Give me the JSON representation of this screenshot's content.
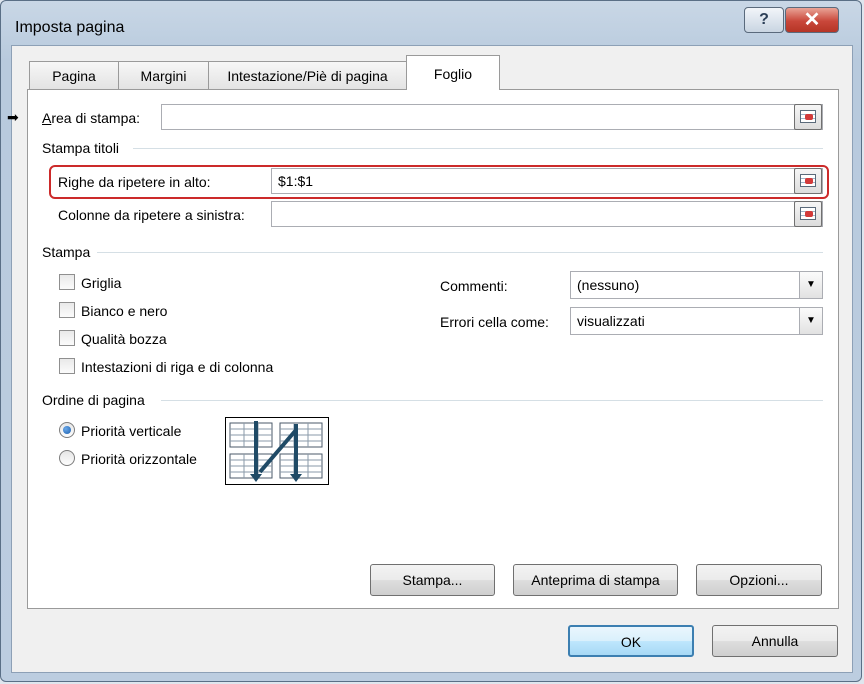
{
  "window": {
    "title": "Imposta pagina",
    "help_glyph": "?",
    "close_glyph": "✕"
  },
  "tabs": [
    {
      "label": "Pagina",
      "active": false
    },
    {
      "label": "Margini",
      "active": false
    },
    {
      "label": "Intestazione/Piè di pagina",
      "active": false
    },
    {
      "label": "Foglio",
      "active": true
    }
  ],
  "print_area": {
    "label": "Area di stampa:",
    "value": ""
  },
  "print_titles": {
    "section": "Stampa titoli",
    "rows": {
      "label": "Righe da ripetere in alto:",
      "value": "$1:$1"
    },
    "cols": {
      "label": "Colonne da ripetere a sinistra:",
      "value": ""
    }
  },
  "print": {
    "section": "Stampa",
    "checkboxes": [
      {
        "label": "Griglia",
        "checked": false
      },
      {
        "label": "Bianco e nero",
        "checked": false
      },
      {
        "label": "Qualità bozza",
        "checked": false
      },
      {
        "label": "Intestazioni di riga e di colonna",
        "checked": false
      }
    ],
    "comments": {
      "label": "Commenti:",
      "value": "(nessuno)"
    },
    "errors": {
      "label": "Errori cella come:",
      "value": "visualizzati"
    }
  },
  "page_order": {
    "section": "Ordine di pagina",
    "options": [
      {
        "label": "Priorità verticale",
        "selected": true
      },
      {
        "label": "Priorità orizzontale",
        "selected": false
      }
    ]
  },
  "buttons": {
    "print": "Stampa...",
    "preview": "Anteprima di stampa",
    "options": "Opzioni...",
    "ok": "OK",
    "cancel": "Annulla"
  },
  "colors": {
    "highlight": "#cc2a2a",
    "default_button_border": "#3c7fb1",
    "close_button": "#c9473a"
  },
  "icons": [
    "help-icon",
    "close-icon",
    "range-selector-icon",
    "dropdown-arrow-icon",
    "page-order-diagram"
  ]
}
